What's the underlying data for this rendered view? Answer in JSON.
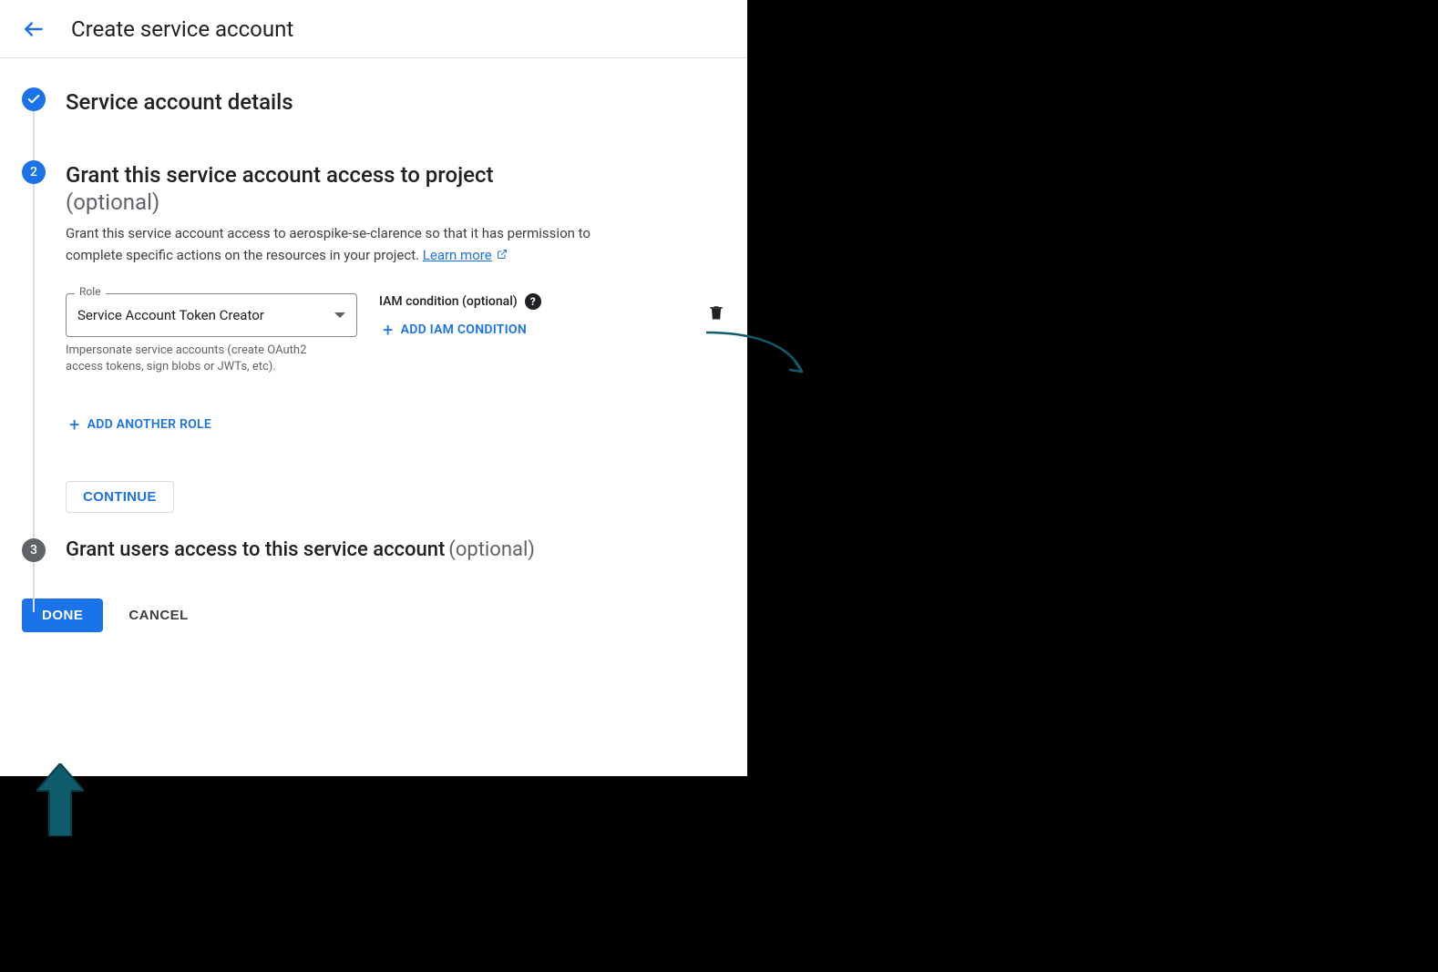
{
  "header": {
    "title": "Create service account"
  },
  "step1": {
    "title": "Service account details"
  },
  "step2": {
    "number": "2",
    "title": "Grant this service account access to project",
    "optional_label": "(optional)",
    "description_prefix": "Grant this service account access to aerospike-se-clarence so that it has permission to complete specific actions on the resources in your project. ",
    "learn_more_label": "Learn more",
    "role": {
      "label": "Role",
      "value": "Service Account Token Creator",
      "helper": "Impersonate service accounts (create OAuth2 access tokens, sign blobs or JWTs, etc)."
    },
    "iam": {
      "label": "IAM condition (optional)",
      "add_label": "ADD IAM CONDITION"
    },
    "add_role_label": "ADD ANOTHER ROLE",
    "continue_label": "CONTINUE"
  },
  "step3": {
    "number": "3",
    "title": "Grant users access to this service account",
    "optional_label": "(optional)"
  },
  "footer": {
    "done_label": "DONE",
    "cancel_label": "CANCEL"
  },
  "colors": {
    "primary": "#1a73e8",
    "annotation": "#0d5b6b"
  }
}
